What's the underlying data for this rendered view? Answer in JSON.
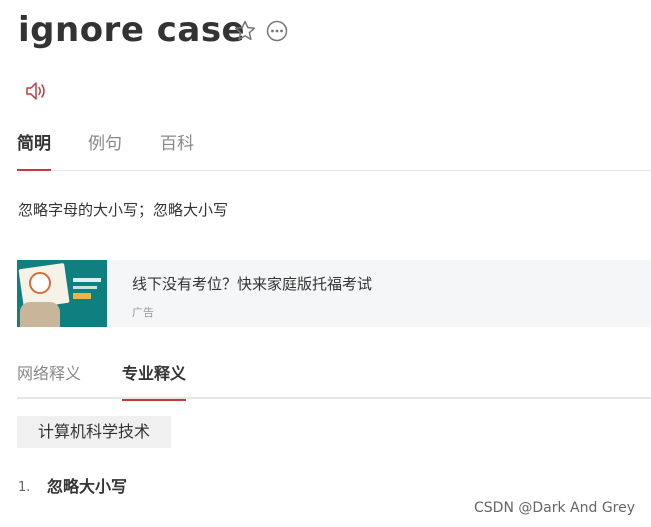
{
  "header": {
    "word": "ignore case",
    "star_icon": "star-icon",
    "more_icon": "more-icon"
  },
  "pronunciation": {
    "icon": "speaker-icon",
    "color": "#c13b3b"
  },
  "top_tabs": [
    {
      "label": "简明",
      "active": true
    },
    {
      "label": "例句",
      "active": false
    },
    {
      "label": "百科",
      "active": false
    }
  ],
  "definition": "忽略字母的大小写；忽略大小写",
  "ad": {
    "title": "线下没有考位？快来家庭版托福考试",
    "label": "广告"
  },
  "bottom_tabs": [
    {
      "label": "网络释义",
      "active": false
    },
    {
      "label": "专业释义",
      "active": true
    }
  ],
  "category": "计算机科学技术",
  "items": [
    {
      "number": "1.",
      "text": "忽略大小写"
    }
  ],
  "watermark": "CSDN @Dark And Grey",
  "colors": {
    "accent": "#c13b3b",
    "text": "#333333",
    "muted": "#888888",
    "ad_bg": "#f5f6f7"
  }
}
